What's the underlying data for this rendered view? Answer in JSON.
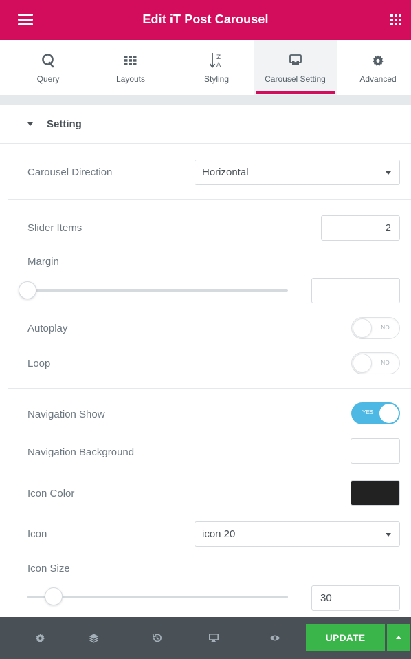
{
  "header": {
    "title": "Edit iT Post Carousel",
    "menu_icon": "hamburger-icon",
    "apps_icon": "apps-grid-icon",
    "bg_color": "#d30c5c"
  },
  "tabs": [
    {
      "label": "Query",
      "icon": "query-q-icon",
      "active": false
    },
    {
      "label": "Layouts",
      "icon": "grid-icon",
      "active": false
    },
    {
      "label": "Styling",
      "icon": "sort-az-icon",
      "active": false
    },
    {
      "label": "Carousel Setting",
      "icon": "carousel-icon",
      "active": true
    },
    {
      "label": "Advanced",
      "icon": "gear-icon",
      "active": false
    }
  ],
  "section": {
    "title": "Setting"
  },
  "controls": {
    "carousel_direction": {
      "label": "Carousel Direction",
      "value": "Horizontal"
    },
    "slider_items": {
      "label": "Slider Items",
      "value": "2"
    },
    "margin": {
      "label": "Margin",
      "value": "",
      "slider_fraction": 0
    },
    "autoplay": {
      "label": "Autoplay",
      "state": "NO"
    },
    "loop": {
      "label": "Loop",
      "state": "NO"
    },
    "navigation_show": {
      "label": "Navigation Show",
      "state": "YES"
    },
    "navigation_background": {
      "label": "Navigation Background",
      "color": "#ffffff"
    },
    "icon_color": {
      "label": "Icon Color",
      "color": "#222222"
    },
    "icon": {
      "label": "Icon",
      "value": "icon 20"
    },
    "icon_size": {
      "label": "Icon Size",
      "value": "30",
      "slider_fraction": 0.1
    }
  },
  "footer": {
    "icons": [
      "gear-icon",
      "layers-icon",
      "history-icon",
      "responsive-desktop-icon",
      "eye-icon"
    ],
    "update_label": "UPDATE",
    "update_color": "#39b54a"
  }
}
